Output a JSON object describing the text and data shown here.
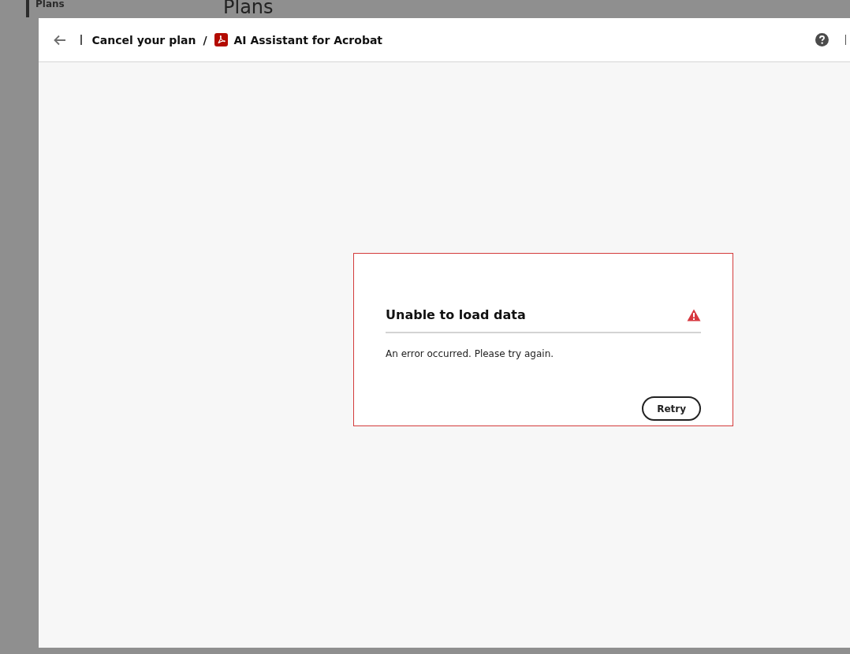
{
  "sidebar": {
    "items": [
      {
        "label": "Plans",
        "selected": true
      }
    ]
  },
  "page": {
    "heading": "Plans"
  },
  "dialog": {
    "breadcrumb": [
      "Cancel your plan",
      "AI Assistant for Acrobat"
    ],
    "separator": "/",
    "error": {
      "title": "Unable to load data",
      "message": "An error occurred. Please try again.",
      "button": "Retry"
    }
  }
}
